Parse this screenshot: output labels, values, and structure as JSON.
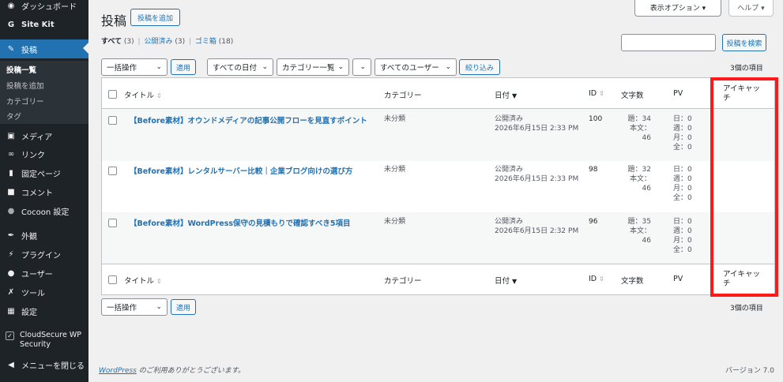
{
  "sidebar": {
    "dashboard": "ダッシュボード",
    "sitekit": "Site Kit",
    "posts": "投稿",
    "sub": [
      "投稿一覧",
      "投稿を追加",
      "カテゴリー",
      "タグ"
    ],
    "media": "メディア",
    "links": "リンク",
    "pages": "固定ページ",
    "comments": "コメント",
    "cocoon": "Cocoon 設定",
    "appearance": "外観",
    "plugins": "プラグイン",
    "users": "ユーザー",
    "tools": "ツール",
    "settings": "設定",
    "cloudsecure": "CloudSecure WP Security",
    "collapse": "メニューを閉じる"
  },
  "header": {
    "title": "投稿",
    "add_new": "投稿を追加",
    "screen_options": "表示オプション ▾",
    "help": "ヘルプ ▾"
  },
  "filters": {
    "all": "すべて",
    "all_count": "(3)",
    "published": "公開済み",
    "published_count": "(3)",
    "trash": "ゴミ箱",
    "trash_count": "(18)",
    "sep": "|",
    "search_placeholder": "",
    "search_button": "投稿を検索",
    "bulk_action": "一括操作",
    "apply": "適用",
    "dates": "すべての日付",
    "categories": "カテゴリー一覧",
    "users": "すべてのユーザー",
    "filter": "絞り込み",
    "item_count": "3個の項目"
  },
  "table": {
    "columns": {
      "title": "タイトル",
      "category": "カテゴリー",
      "date": "日付",
      "id": "ID",
      "wordcount": "文字数",
      "pv": "PV",
      "eyecatch_1": "アイキャッ",
      "eyecatch_2": "チ"
    },
    "rows": [
      {
        "title": "【Before素材】オウンドメディアの記事公開フローを見直すポイント",
        "category": "未分類",
        "status": "公開済み",
        "date": "2026年6月15日 2:33 PM",
        "id": "100",
        "wc_title": "題：34",
        "wc_body": "本文：46",
        "pv": [
          "日：0",
          "週：0",
          "月：0",
          "全：0"
        ]
      },
      {
        "title": "【Before素材】レンタルサーバー比較｜企業ブログ向けの選び方",
        "category": "未分類",
        "status": "公開済み",
        "date": "2026年6月15日 2:33 PM",
        "id": "98",
        "wc_title": "題：32",
        "wc_body": "本文：46",
        "pv": [
          "日：0",
          "週：0",
          "月：0",
          "全：0"
        ]
      },
      {
        "title": "【Before素材】WordPress保守の見積もりで確認すべき5項目",
        "category": "未分類",
        "status": "公開済み",
        "date": "2026年6月15日 2:32 PM",
        "id": "96",
        "wc_title": "題：35",
        "wc_body": "本文：46",
        "pv": [
          "日：0",
          "週：0",
          "月：0",
          "全：0"
        ]
      }
    ]
  },
  "footer": {
    "wp_link": "WordPress",
    "thanks": " のご利用ありがとうございます。",
    "version": "バージョン 7.0"
  },
  "colors": {
    "accent": "#2271b1",
    "sidebar": "#1d2327",
    "highlight": "#ff1a1a"
  }
}
